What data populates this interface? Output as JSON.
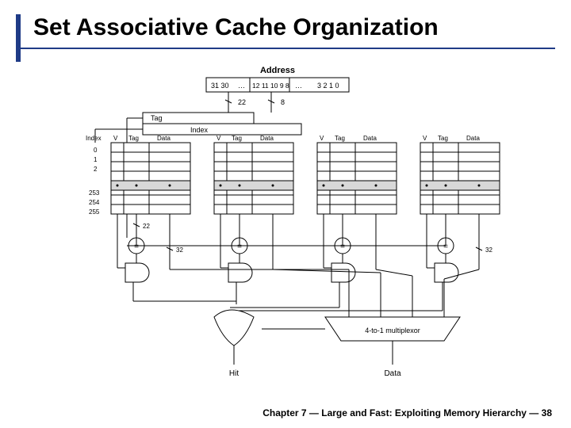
{
  "title": "Set Associative Cache Organization",
  "footer": "Chapter 7 — Large and Fast: Exploiting Memory Hierarchy — 38",
  "diagram": {
    "top_label": "Address",
    "addr_bits": [
      "31 30",
      "…",
      "12 11 10 9 8",
      "…",
      "3 2 1 0"
    ],
    "bus_widths": {
      "tag_bits": "22",
      "index_bits": "8",
      "data_bits": "32"
    },
    "addr_field_labels": {
      "tag": "Tag",
      "index": "Index"
    },
    "way_columns": [
      "V",
      "Tag",
      "Data"
    ],
    "index_header": "Index",
    "index_values": [
      "0",
      "1",
      "2",
      "253",
      "254",
      "255"
    ],
    "compare": "=",
    "mux_label": "4-to-1 multiplexor",
    "outputs": {
      "hit": "Hit",
      "data": "Data"
    }
  }
}
